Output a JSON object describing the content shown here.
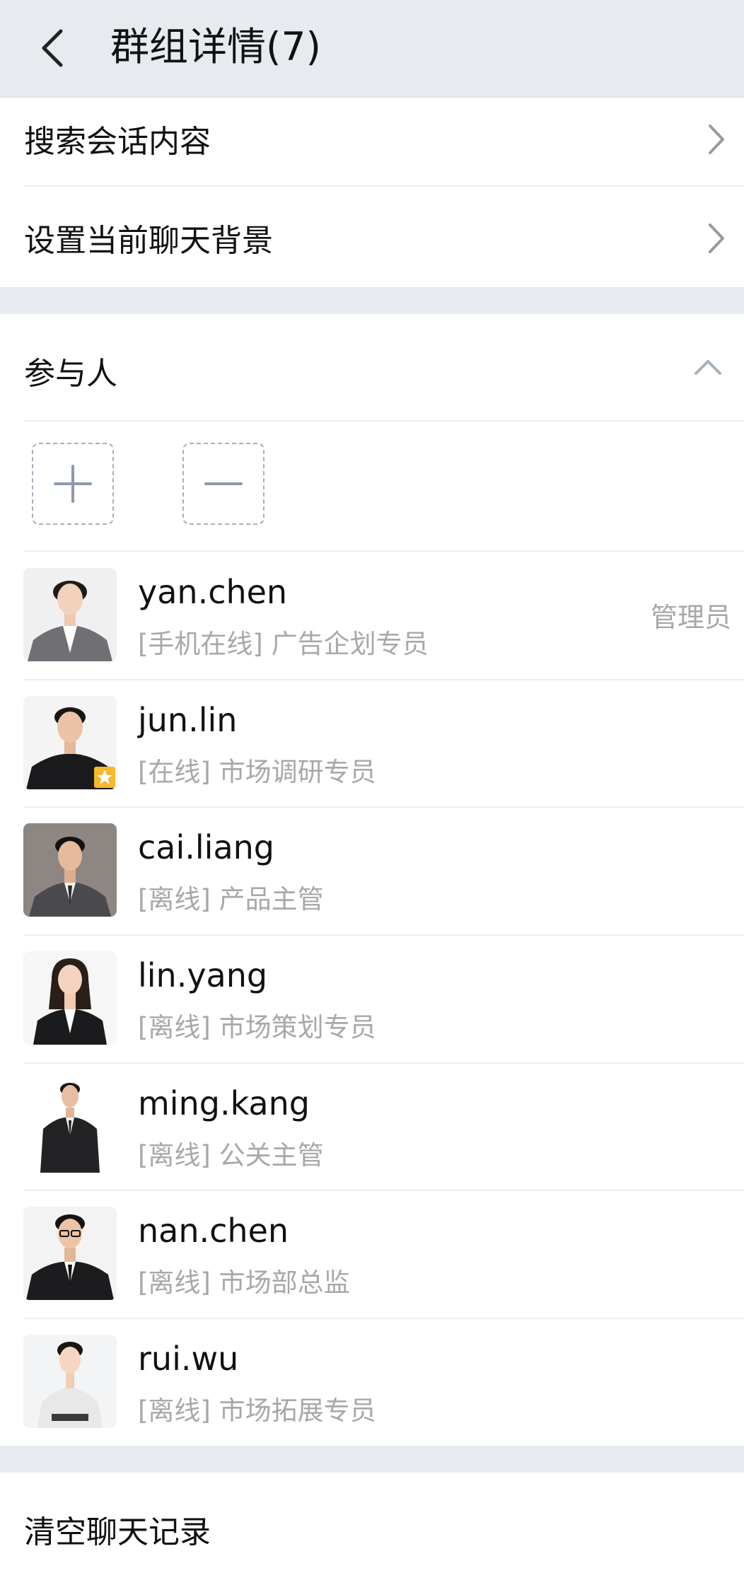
{
  "header": {
    "title": "群组详情(7)"
  },
  "menu": {
    "search_label": "搜索会话内容",
    "background_label": "设置当前聊天背景"
  },
  "participants": {
    "section_label": "参与人",
    "add_icon": "plus-icon",
    "remove_icon": "minus-icon",
    "members": [
      {
        "name": "yan.chen",
        "status": "[手机在线] 广告企划专员",
        "role": "管理员"
      },
      {
        "name": "jun.lin",
        "status": "[在线] 市场调研专员",
        "badge": "star-icon"
      },
      {
        "name": "cai.liang",
        "status": "[离线] 产品主管"
      },
      {
        "name": "lin.yang",
        "status": "[离线] 市场策划专员"
      },
      {
        "name": "ming.kang",
        "status": "[离线] 公关主管"
      },
      {
        "name": "nan.chen",
        "status": "[离线] 市场部总监"
      },
      {
        "name": "rui.wu",
        "status": "[离线] 市场拓展专员"
      }
    ]
  },
  "footer": {
    "clear_label": "清空聊天记录"
  },
  "colors": {
    "header_bg": "#e7eaee",
    "secondary_text": "#a8a8a8",
    "icon_gray": "#a7b0bd",
    "badge_yellow": "#f5b82e"
  }
}
